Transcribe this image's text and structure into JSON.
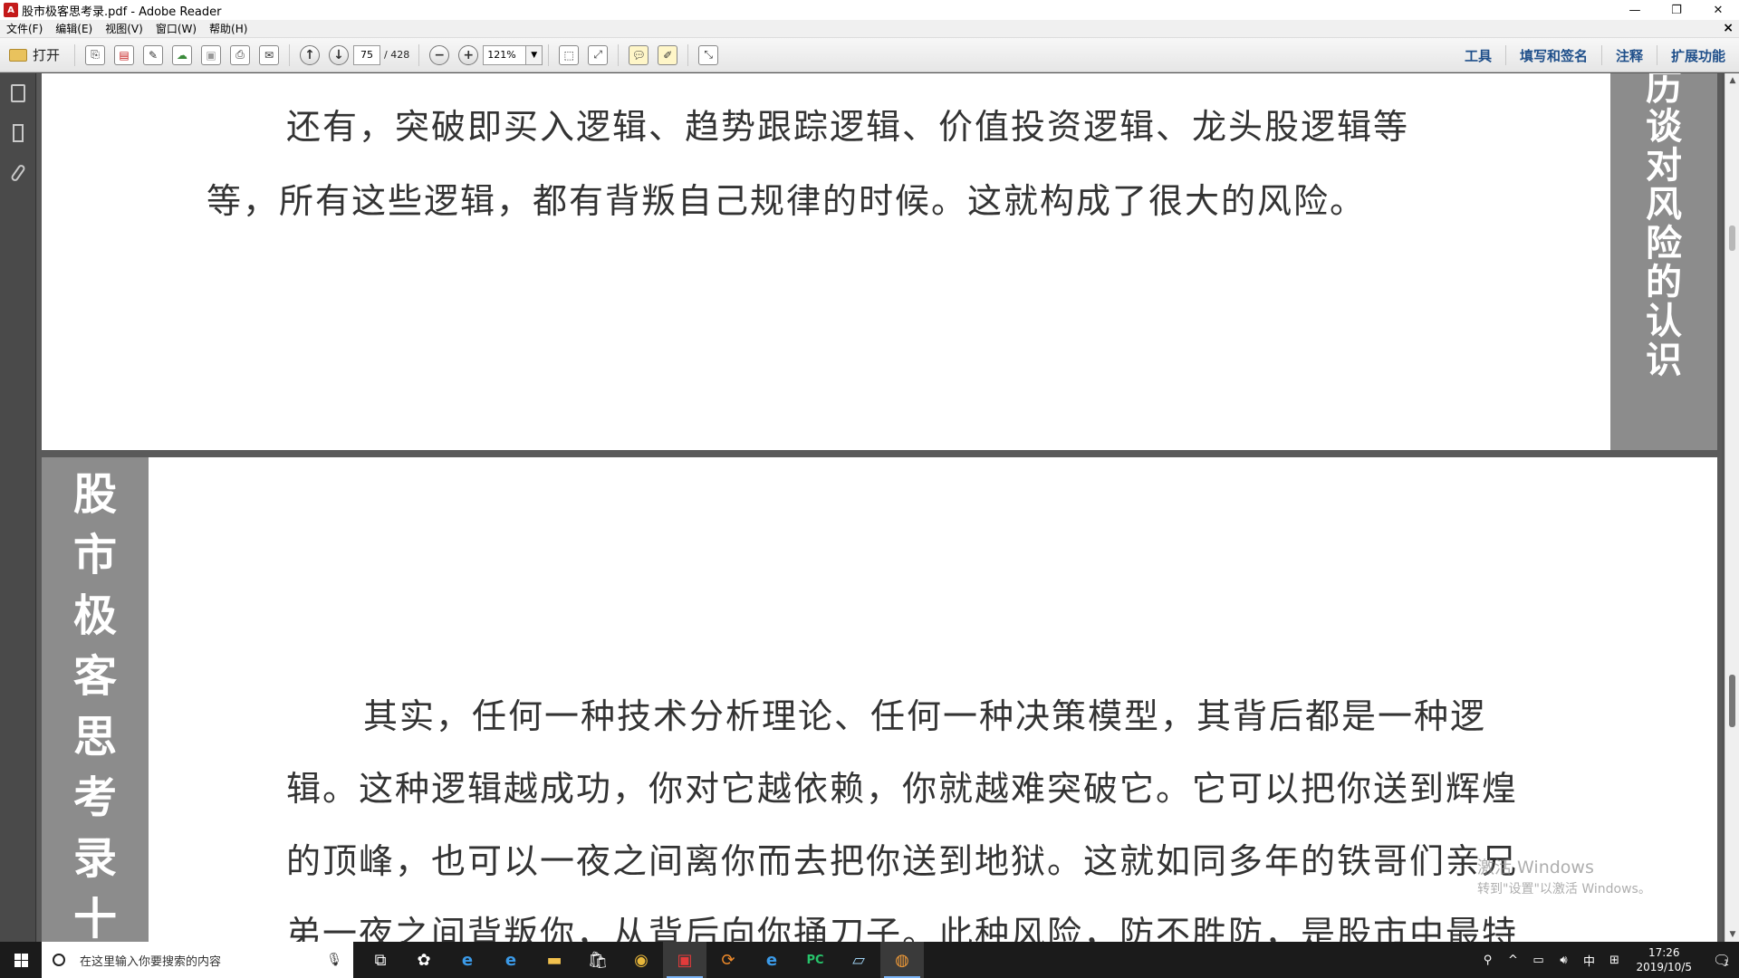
{
  "window": {
    "title": "股市极客思考录.pdf - Adobe Reader",
    "app_icon": "pdf-icon",
    "minimize_glyph": "—",
    "restore_glyph": "❐",
    "close_glyph": "✕"
  },
  "menubar": {
    "items": [
      "文件(F)",
      "编辑(E)",
      "视图(V)",
      "窗口(W)",
      "帮助(H)"
    ],
    "doc_close": "×"
  },
  "toolbar": {
    "open_label": "打开",
    "page_current": "75",
    "page_total": "/ 428",
    "zoom": "121%",
    "right_tabs": [
      "工具",
      "填写和签名",
      "注释",
      "扩展功能"
    ]
  },
  "document": {
    "top_page": {
      "lines": [
        "还有，突破即买入逻辑、趋势跟踪逻辑、价值投资逻辑、龙头股逻辑等",
        "等，所有这些逻辑，都有背叛自己规律的时候。这就构成了很大的风险。"
      ],
      "side_title": "历谈对风险的认识"
    },
    "bottom_page": {
      "side_title": "股市极客思考录十",
      "lines": [
        "其实，任何一种技术分析理论、任何一种决策模型，其背后都是一种逻",
        "辑。这种逻辑越成功，你对它越依赖，你就越难突破它。它可以把你送到辉煌",
        "的顶峰，也可以一夜之间离你而去把你送到地狱。这就如同多年的铁哥们亲兄",
        "弟一夜之间背叛你，从背后向你捅刀子。此种风险，防不胜防，是股市中最特"
      ]
    }
  },
  "watermark": {
    "line1": "激活 Windows",
    "line2": "转到\"设置\"以激活 Windows。"
  },
  "taskbar": {
    "search_placeholder": "在这里输入你要搜索的内容",
    "clock_time": "17:26",
    "clock_date": "2019/10/5",
    "ime_label": "中",
    "notification_count": "1"
  }
}
